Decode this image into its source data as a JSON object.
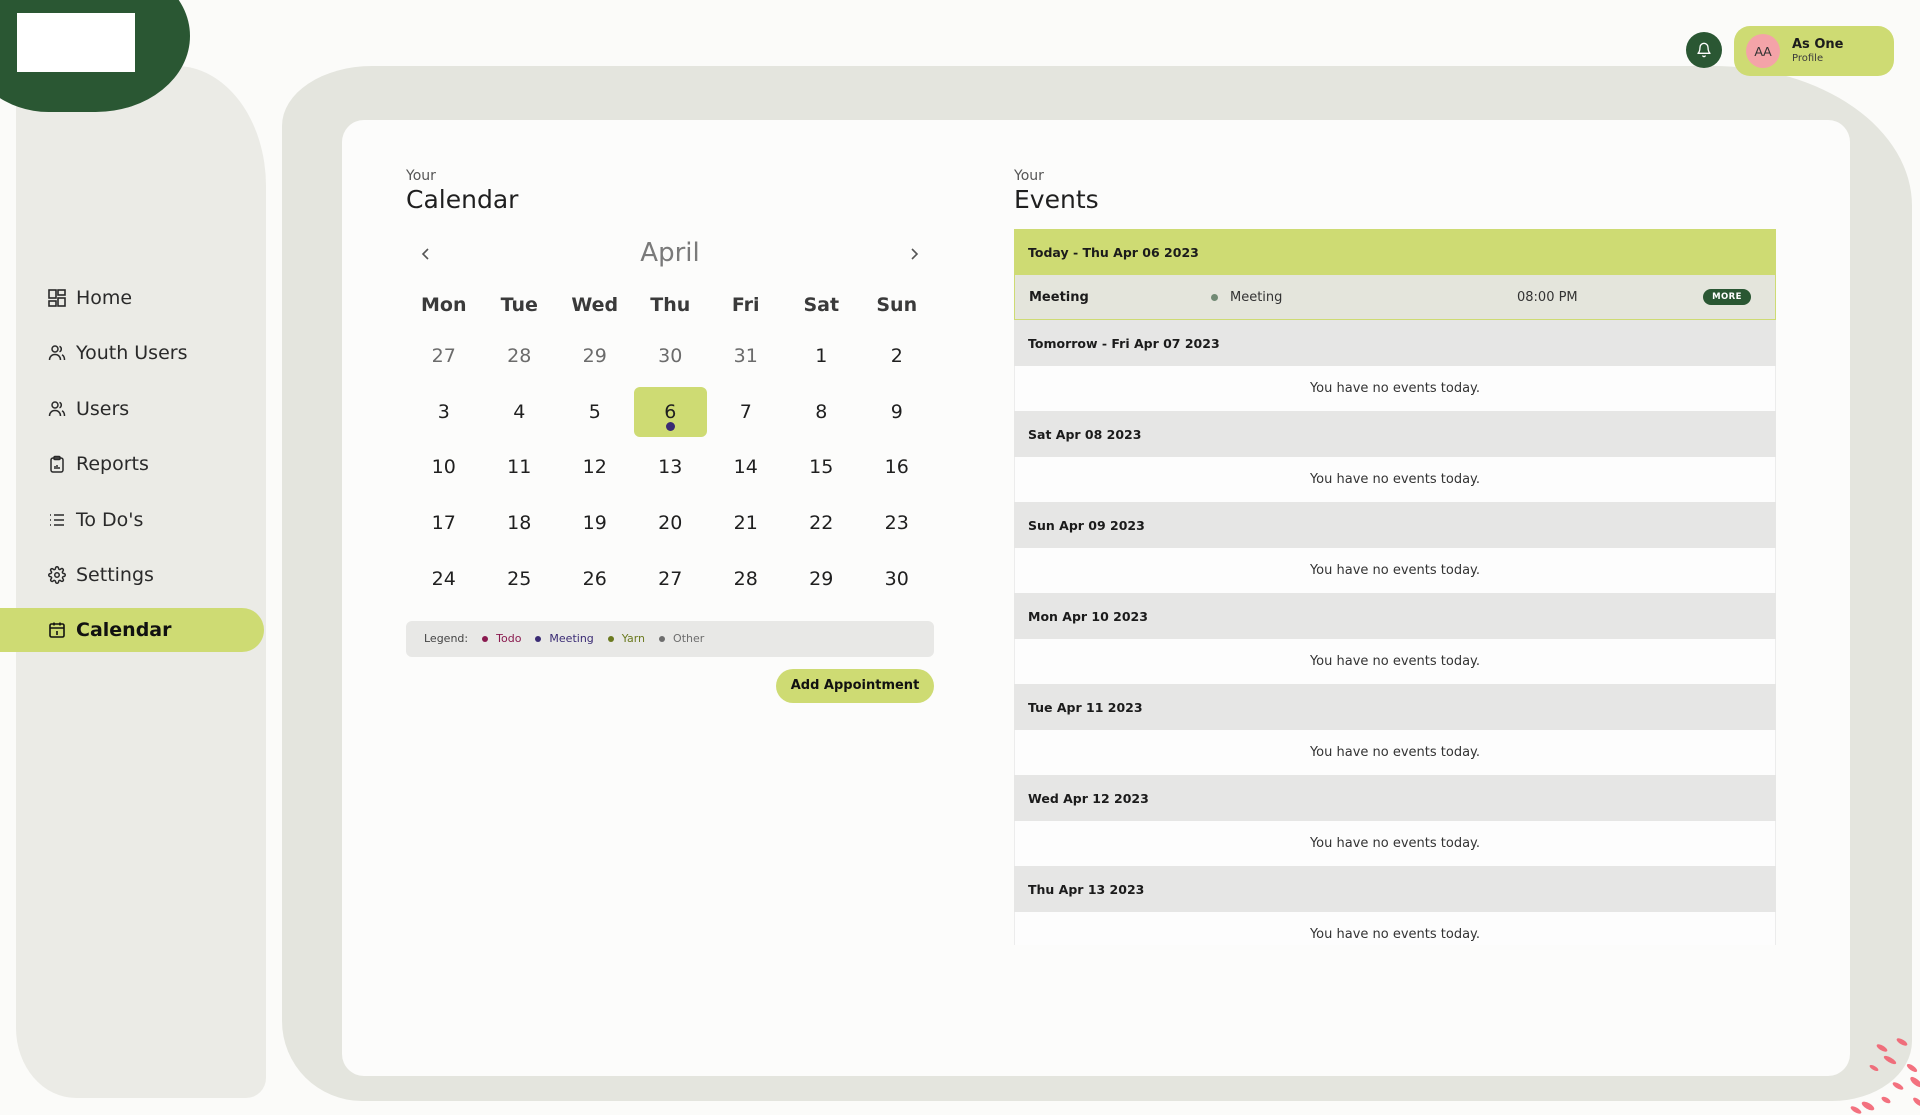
{
  "header": {
    "notification_icon": "bell-icon",
    "profile": {
      "initials": "AA",
      "name": "As One",
      "subtitle": "Profile"
    }
  },
  "sidebar": {
    "items": [
      {
        "label": "Home",
        "icon": "dashboard-grid-icon",
        "active": false
      },
      {
        "label": "Youth Users",
        "icon": "users-icon",
        "active": false
      },
      {
        "label": "Users",
        "icon": "users-icon",
        "active": false
      },
      {
        "label": "Reports",
        "icon": "clipboard-report-icon",
        "active": false
      },
      {
        "label": "To Do's",
        "icon": "list-icon",
        "active": false
      },
      {
        "label": "Settings",
        "icon": "gear-icon",
        "active": false
      },
      {
        "label": "Calendar",
        "icon": "calendar-icon",
        "active": true
      }
    ]
  },
  "calendar": {
    "kicker": "Your",
    "title": "Calendar",
    "month": "April",
    "prev_icon": "chevron-left-icon",
    "next_icon": "chevron-right-icon",
    "weekdays": [
      "Mon",
      "Tue",
      "Wed",
      "Thu",
      "Fri",
      "Sat",
      "Sun"
    ],
    "weeks": [
      [
        {
          "d": "27",
          "muted": true
        },
        {
          "d": "28",
          "muted": true
        },
        {
          "d": "29",
          "muted": true
        },
        {
          "d": "30",
          "muted": true
        },
        {
          "d": "31",
          "muted": true
        },
        {
          "d": "1"
        },
        {
          "d": "2"
        }
      ],
      [
        {
          "d": "3"
        },
        {
          "d": "4"
        },
        {
          "d": "5"
        },
        {
          "d": "6",
          "today": true,
          "dot": "meeting"
        },
        {
          "d": "7"
        },
        {
          "d": "8"
        },
        {
          "d": "9"
        }
      ],
      [
        {
          "d": "10"
        },
        {
          "d": "11"
        },
        {
          "d": "12"
        },
        {
          "d": "13"
        },
        {
          "d": "14"
        },
        {
          "d": "15"
        },
        {
          "d": "16"
        }
      ],
      [
        {
          "d": "17"
        },
        {
          "d": "18"
        },
        {
          "d": "19"
        },
        {
          "d": "20"
        },
        {
          "d": "21"
        },
        {
          "d": "22"
        },
        {
          "d": "23"
        }
      ],
      [
        {
          "d": "24"
        },
        {
          "d": "25"
        },
        {
          "d": "26"
        },
        {
          "d": "27"
        },
        {
          "d": "28"
        },
        {
          "d": "29"
        },
        {
          "d": "30"
        }
      ]
    ],
    "legend": {
      "label": "Legend:",
      "items": [
        {
          "label": "Todo",
          "color": "#8a1a4f"
        },
        {
          "label": "Meeting",
          "color": "#3a2b74"
        },
        {
          "label": "Yarn",
          "color": "#6b7a1f"
        },
        {
          "label": "Other",
          "color": "#6d6d6d"
        }
      ]
    },
    "add_button": "Add Appointment"
  },
  "events": {
    "kicker": "Your",
    "title": "Events",
    "days": [
      {
        "header": "Today - Thu Apr 06 2023",
        "today": true,
        "events": [
          {
            "title": "Meeting",
            "type": "Meeting",
            "time": "08:00 PM",
            "action": "MORE"
          }
        ]
      },
      {
        "header": "Tomorrow - Fri Apr 07 2023",
        "empty": "You have no events today."
      },
      {
        "header": "Sat Apr 08 2023",
        "empty": "You have no events today."
      },
      {
        "header": "Sun Apr 09 2023",
        "empty": "You have no events today."
      },
      {
        "header": "Mon Apr 10 2023",
        "empty": "You have no events today."
      },
      {
        "header": "Tue Apr 11 2023",
        "empty": "You have no events today."
      },
      {
        "header": "Wed Apr 12 2023",
        "empty": "You have no events today."
      },
      {
        "header": "Thu Apr 13 2023",
        "empty": "You have no events today."
      }
    ]
  },
  "colors": {
    "brand_green": "#2a5733",
    "accent_lime": "#cedb73",
    "avatar_pink": "#f4a3a8",
    "meeting_dot": "#3a2b74"
  }
}
